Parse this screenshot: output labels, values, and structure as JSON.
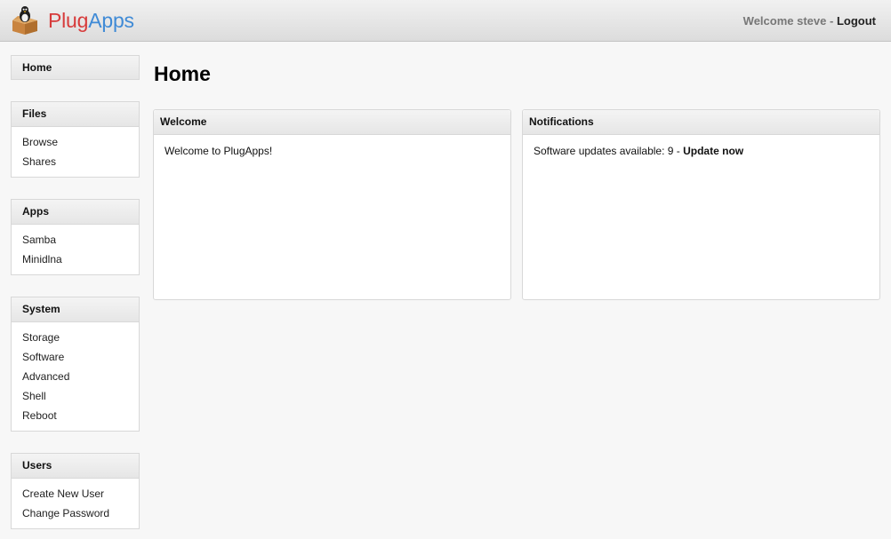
{
  "app": {
    "name_part1": "Plug",
    "name_part2": "Apps",
    "logo_icon": "tux-in-box-icon"
  },
  "header": {
    "welcome_text": "Welcome steve",
    "separator": "-",
    "logout_label": "Logout"
  },
  "sidebar": {
    "home_label": "Home",
    "groups": [
      {
        "title": "Files",
        "items": [
          "Browse",
          "Shares"
        ]
      },
      {
        "title": "Apps",
        "items": [
          "Samba",
          "Minidlna"
        ]
      },
      {
        "title": "System",
        "items": [
          "Storage",
          "Software",
          "Advanced",
          "Shell",
          "Reboot"
        ]
      },
      {
        "title": "Users",
        "items": [
          "Create New User",
          "Change Password"
        ]
      }
    ]
  },
  "main": {
    "title": "Home",
    "welcome_panel": {
      "title": "Welcome",
      "text": "Welcome to PlugApps!"
    },
    "notifications_panel": {
      "title": "Notifications",
      "updates_text": "Software updates available: 9 -",
      "update_link": "Update now"
    }
  },
  "colors": {
    "brand_red": "#d73b3b",
    "brand_blue": "#3f8ad6"
  }
}
